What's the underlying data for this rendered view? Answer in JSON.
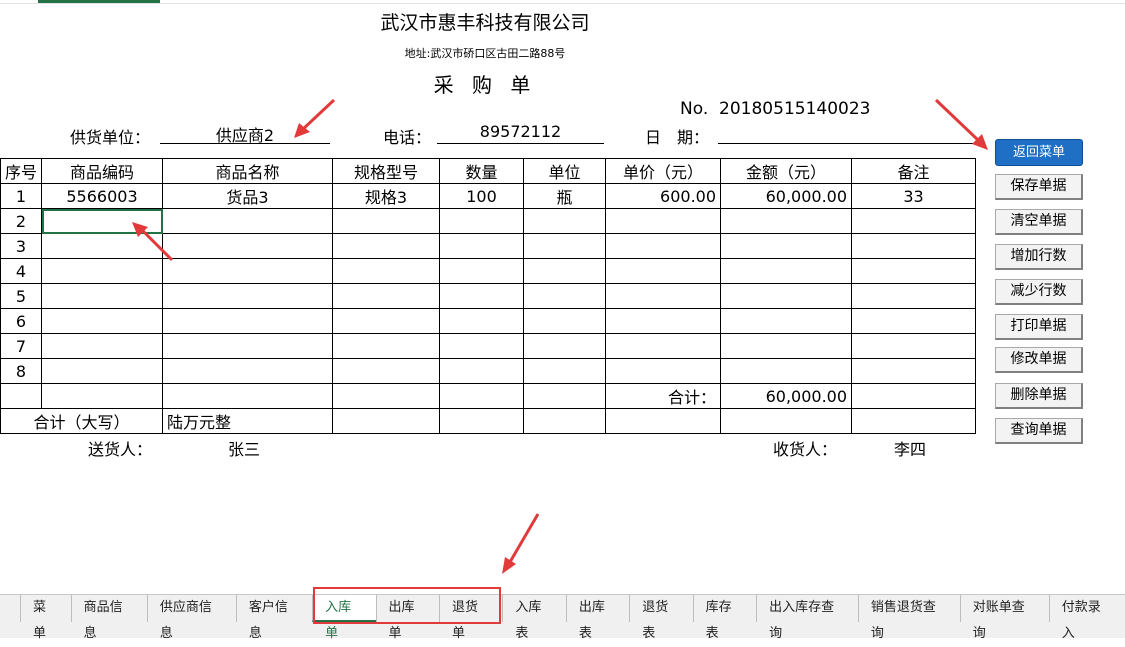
{
  "header": {
    "company": "武汉市惠丰科技有限公司",
    "address": "地址:武汉市硚口区古田二路88号",
    "doc_title": "采 购 单",
    "no_label": "No.",
    "no_value": "20180515140023",
    "supplier_label": "供货单位：",
    "supplier_value": "供应商2",
    "phone_label": "电话：",
    "phone_value": "89572112",
    "date_label": "日　期：",
    "date_value": ""
  },
  "table": {
    "columns": [
      "序号",
      "商品编码",
      "商品名称",
      "规格型号",
      "数量",
      "单位",
      "单价（元）",
      "金额（元）",
      "备注"
    ],
    "rows": [
      [
        "1",
        "5566003",
        "货品3",
        "规格3",
        "100",
        "瓶",
        "600.00",
        "60,000.00",
        "33"
      ],
      [
        "2",
        "",
        "",
        "",
        "",
        "",
        "",
        "",
        ""
      ],
      [
        "3",
        "",
        "",
        "",
        "",
        "",
        "",
        "",
        ""
      ],
      [
        "4",
        "",
        "",
        "",
        "",
        "",
        "",
        "",
        ""
      ],
      [
        "5",
        "",
        "",
        "",
        "",
        "",
        "",
        "",
        ""
      ],
      [
        "6",
        "",
        "",
        "",
        "",
        "",
        "",
        "",
        ""
      ],
      [
        "7",
        "",
        "",
        "",
        "",
        "",
        "",
        "",
        ""
      ],
      [
        "8",
        "",
        "",
        "",
        "",
        "",
        "",
        "",
        ""
      ]
    ],
    "total_label": "合计：",
    "total_value": "60,000.00",
    "capital_label": "合计（大写）",
    "capital_value": "陆万元整"
  },
  "footer": {
    "deliverer_label": "送货人：",
    "deliverer_value": "张三",
    "receiver_label": "收货人：",
    "receiver_value": "李四"
  },
  "side_buttons": [
    {
      "label": "返回菜单",
      "primary": true
    },
    {
      "label": "保存单据"
    },
    {
      "label": "清空单据"
    },
    {
      "label": "增加行数"
    },
    {
      "label": "减少行数"
    },
    {
      "label": "打印单据"
    },
    {
      "label": "修改单据"
    },
    {
      "label": "删除单据"
    },
    {
      "label": "查询单据"
    }
  ],
  "sheet_tabs": [
    {
      "label": "菜单"
    },
    {
      "label": "商品信息"
    },
    {
      "label": "供应商信息"
    },
    {
      "label": "客户信息"
    },
    {
      "label": "入库单",
      "active": true
    },
    {
      "label": "出库单"
    },
    {
      "label": "退货单"
    },
    {
      "label": "入库表"
    },
    {
      "label": "出库表"
    },
    {
      "label": "退货表"
    },
    {
      "label": "库存表"
    },
    {
      "label": "出入库存查询"
    },
    {
      "label": "销售退货查询"
    },
    {
      "label": "对账单查询"
    },
    {
      "label": "付款录入"
    }
  ],
  "colors": {
    "accent": "#217346",
    "primary_button": "#1f6fc5",
    "annotation": "#e23a3a"
  }
}
